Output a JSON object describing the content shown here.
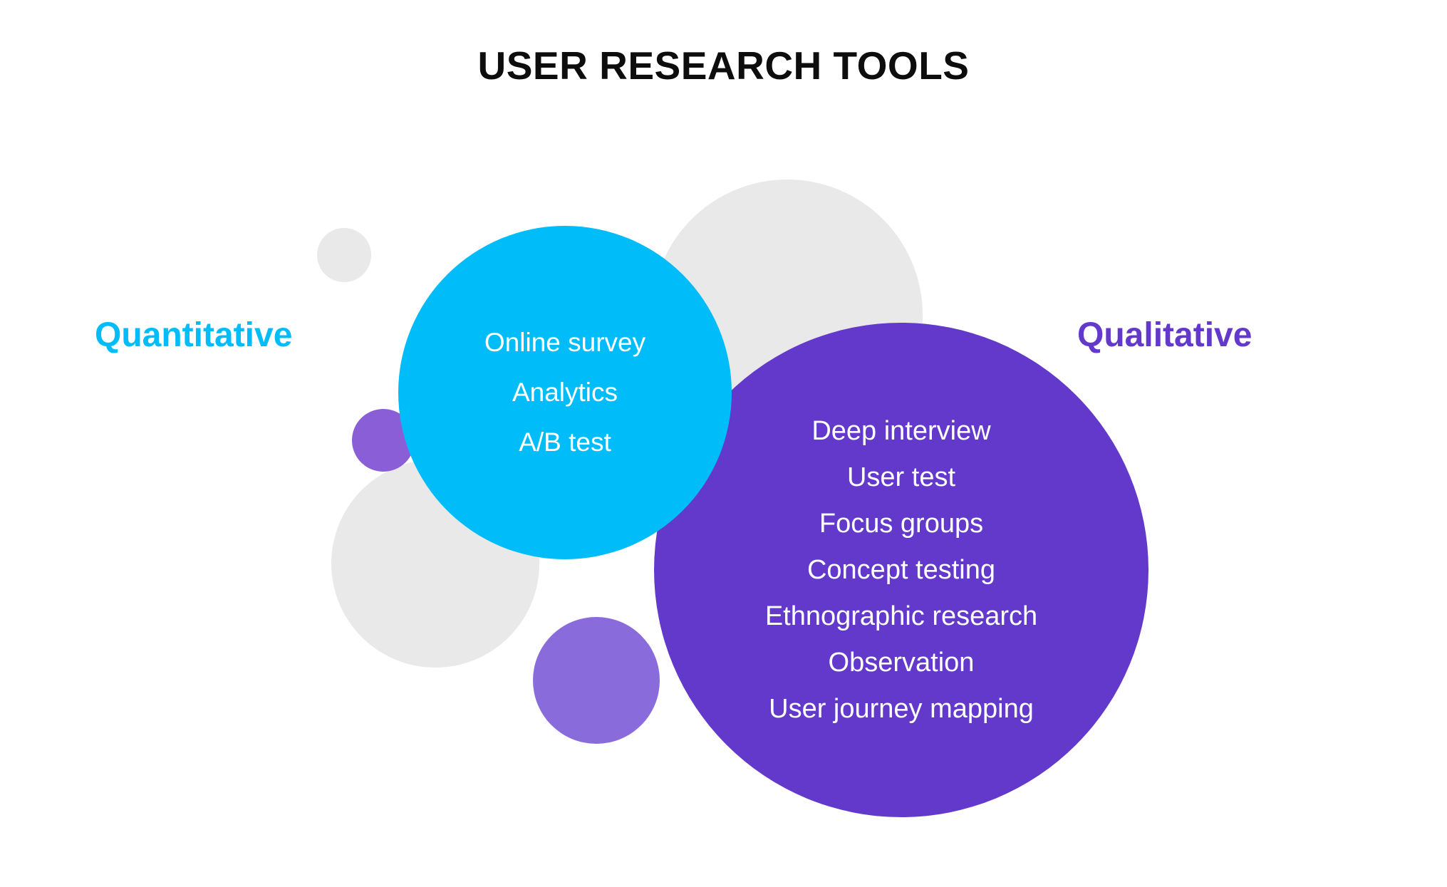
{
  "page": {
    "title": "USER RESEARCH TOOLS",
    "background_color": "#ffffff",
    "title_color": "#0d0d0d"
  },
  "categories": {
    "left": {
      "label": "Quantitative",
      "color": "#00bdfa"
    },
    "right": {
      "label": "Qualitative",
      "color": "#6339cc"
    }
  },
  "bubbles": {
    "quantitative": {
      "fill_color": "#00bdfa",
      "text_color": "#ffffff",
      "items": [
        "Online survey",
        "Analytics",
        "A/B test"
      ]
    },
    "qualitative": {
      "fill_color": "#6339cc",
      "text_color": "#ffffff",
      "items": [
        "Deep interview",
        "User test",
        "Focus groups",
        "Concept testing",
        "Ethnographic research",
        "Observation",
        "User journey mapping"
      ]
    }
  },
  "decorations": {
    "gray_color": "#e9e9e9",
    "violet_color": "#8a6bdc"
  }
}
